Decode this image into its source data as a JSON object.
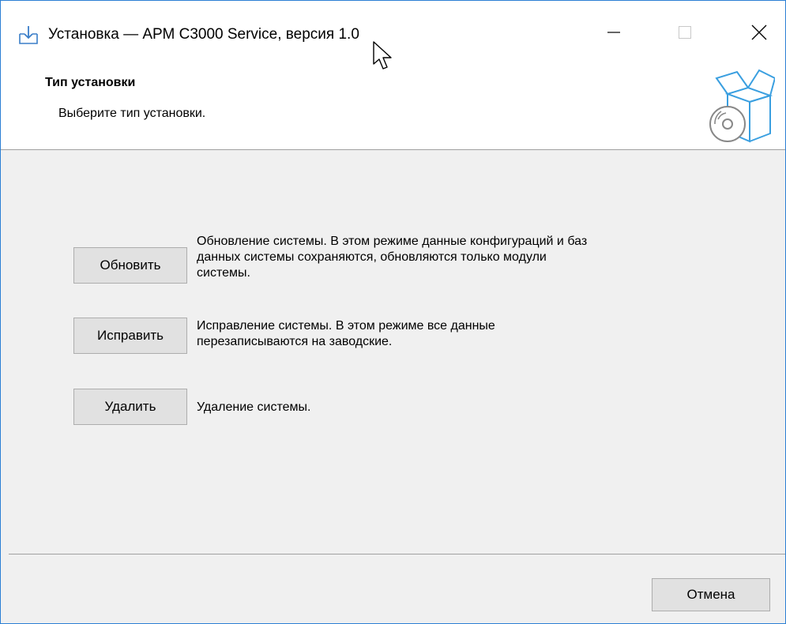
{
  "window": {
    "title": "Установка — АРМ С3000 Service, версия 1.0"
  },
  "header": {
    "title": "Тип установки",
    "subtitle": "Выберите тип установки."
  },
  "options": [
    {
      "button_label": "Обновить",
      "description_lines": [
        "Обновление системы. В этом режиме данные конфигураций и баз",
        "данных системы сохраняются, обновляются только модули",
        "системы."
      ]
    },
    {
      "button_label": "Исправить",
      "description_lines": [
        "Исправление системы. В этом режиме все данные",
        "перезаписываются на заводские."
      ]
    },
    {
      "button_label": "Удалить",
      "description_lines": [
        "Удаление системы."
      ]
    }
  ],
  "footer": {
    "cancel_label": "Отмена"
  },
  "icons": {
    "title_icon": "install-download-icon",
    "header_image": "box-with-disc-icon",
    "minimize": "minimize-icon",
    "maximize": "maximize-icon",
    "close": "close-icon"
  },
  "colors": {
    "accent": "#2b7fd4",
    "button_face": "#e1e1e1",
    "panel": "#f0f0f0"
  }
}
